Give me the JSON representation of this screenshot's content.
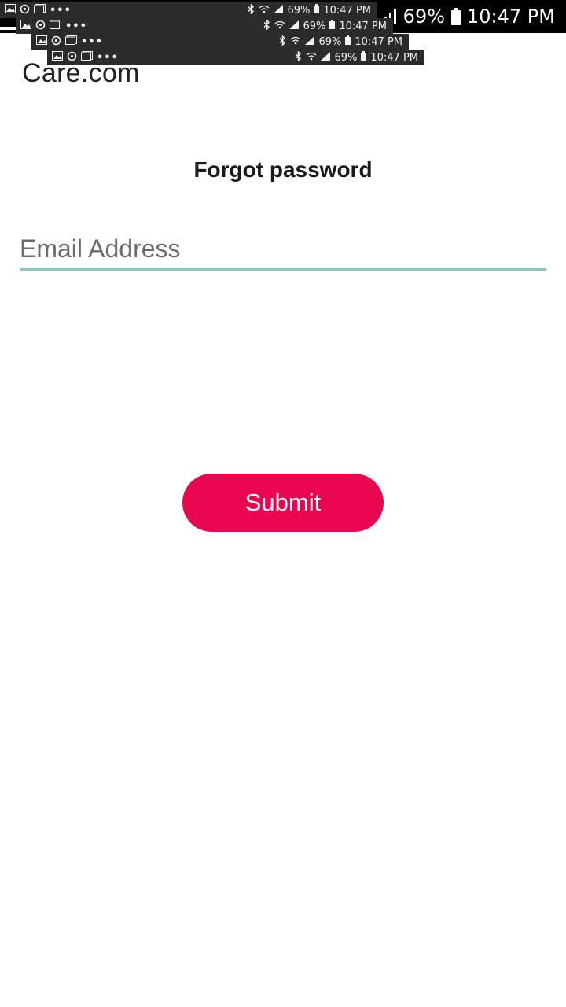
{
  "status_bar": {
    "battery": "69%",
    "time": "10:47 PM",
    "icons": [
      "wifi-icon",
      "signal-icon",
      "battery-icon"
    ]
  },
  "ghost_status_bars": {
    "battery": "69%",
    "time": "10:47 PM",
    "more": "•••",
    "icons": [
      "image-icon",
      "sync-icon",
      "gallery-icon",
      "bluetooth-icon",
      "wifi-icon",
      "signal-icon",
      "battery-icon"
    ]
  },
  "header": {
    "brand": "Care.com"
  },
  "form": {
    "title": "Forgot password",
    "email_placeholder": "Email Address",
    "email_value": "",
    "submit_label": "Submit"
  },
  "colors": {
    "accent": "#e8064f",
    "input_underline": "#88c9c9",
    "status_bar_bg": "#000000",
    "ghost_bar_bg": "#2b2b2b"
  }
}
